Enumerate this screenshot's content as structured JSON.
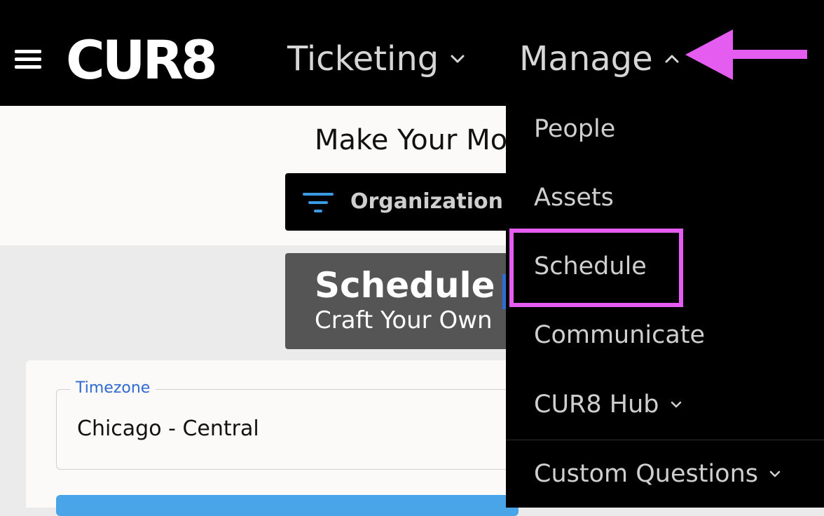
{
  "header": {
    "logo": "CUR8",
    "nav": [
      {
        "label": "Ticketing",
        "state": "collapsed"
      },
      {
        "label": "Manage",
        "state": "expanded"
      }
    ]
  },
  "page": {
    "headline": "Make Your Mo",
    "filter_label": "Organization",
    "schedule_title": "Schedule",
    "schedule_subtitle": "Craft Your Own",
    "timezone_label": "Timezone",
    "timezone_value": "Chicago - Central"
  },
  "manage_menu": {
    "items": [
      {
        "label": "People"
      },
      {
        "label": "Assets"
      },
      {
        "label": "Schedule",
        "highlighted": true
      },
      {
        "label": "Communicate"
      },
      {
        "label": "CUR8 Hub",
        "has_submenu": true
      },
      {
        "label": "Custom Questions",
        "has_submenu": true
      }
    ]
  },
  "colors": {
    "annotation": "#e55df0",
    "topbar": "#000000",
    "link_blue": "#2f6ad0",
    "button_blue": "#4aa4e8"
  },
  "icons": [
    "hamburger-icon",
    "chevron-down-icon",
    "chevron-up-icon",
    "filter-icon",
    "arrow-left-icon"
  ]
}
